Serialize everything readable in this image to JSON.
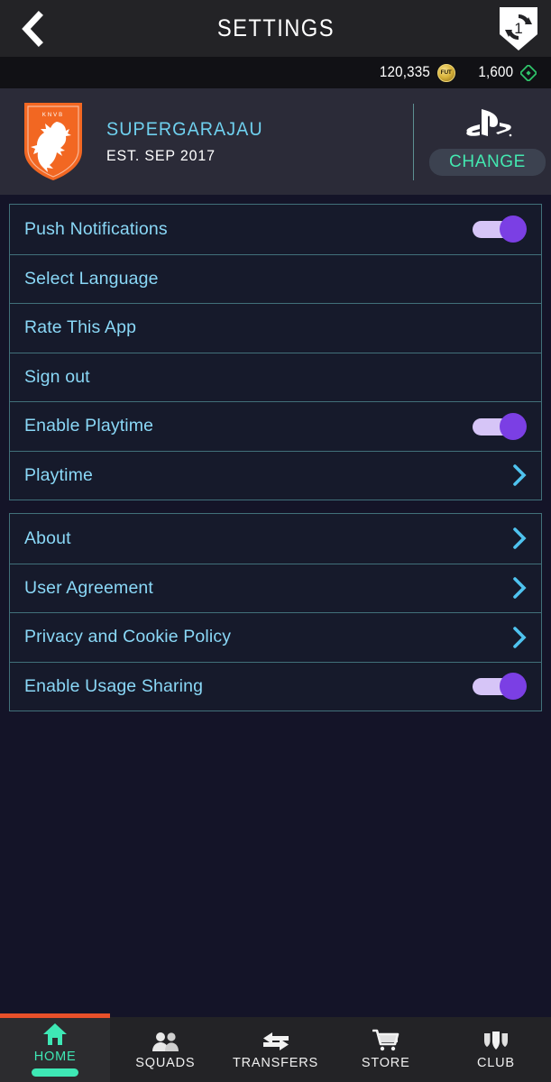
{
  "header": {
    "title": "SETTINGS",
    "back_icon": "chevron-left-icon",
    "sync_icon": "squad-update-shield-icon",
    "sync_badge": "1"
  },
  "currency": {
    "coins": "120,335",
    "coins_icon": "fut-coin-icon",
    "coins_icon_text": "FUT",
    "points": "1,600",
    "points_icon": "fifa-points-icon"
  },
  "club": {
    "crest_icon": "knvb-lion-crest-icon",
    "name": "SUPERGARAJAU",
    "established": "EST. SEP 2017",
    "platform_icon": "playstation-logo-icon",
    "change_label": "CHANGE"
  },
  "groups": [
    {
      "rows": [
        {
          "label": "Push Notifications",
          "control": "toggle",
          "value": "on"
        },
        {
          "label": "Select Language",
          "control": "none"
        },
        {
          "label": "Rate This App",
          "control": "none"
        },
        {
          "label": "Sign out",
          "control": "none"
        },
        {
          "label": "Enable Playtime",
          "control": "toggle",
          "value": "on"
        },
        {
          "label": "Playtime",
          "control": "chevron"
        }
      ]
    },
    {
      "rows": [
        {
          "label": "About",
          "control": "chevron"
        },
        {
          "label": "User Agreement",
          "control": "chevron"
        },
        {
          "label": "Privacy and Cookie Policy",
          "control": "chevron"
        },
        {
          "label": "Enable Usage Sharing",
          "control": "toggle",
          "value": "on"
        }
      ]
    }
  ],
  "bottom_nav": {
    "items": [
      {
        "label": "HOME",
        "icon": "home-icon",
        "active": true
      },
      {
        "label": "SQUADS",
        "icon": "squads-people-icon",
        "active": false
      },
      {
        "label": "TRANSFERS",
        "icon": "transfers-arrows-icon",
        "active": false
      },
      {
        "label": "STORE",
        "icon": "store-cart-icon",
        "active": false
      },
      {
        "label": "CLUB",
        "icon": "club-crest-icon",
        "active": false
      }
    ]
  },
  "colors": {
    "accent_orange": "#e8502a",
    "active_mint": "#3ee8b5",
    "label_cyan": "#8ad8f7",
    "toggle_purple": "#7b3fe4",
    "toggle_track": "#d6c5f7",
    "border_teal": "#41707a",
    "crest_orange": "#f26722",
    "background": "#141428"
  }
}
